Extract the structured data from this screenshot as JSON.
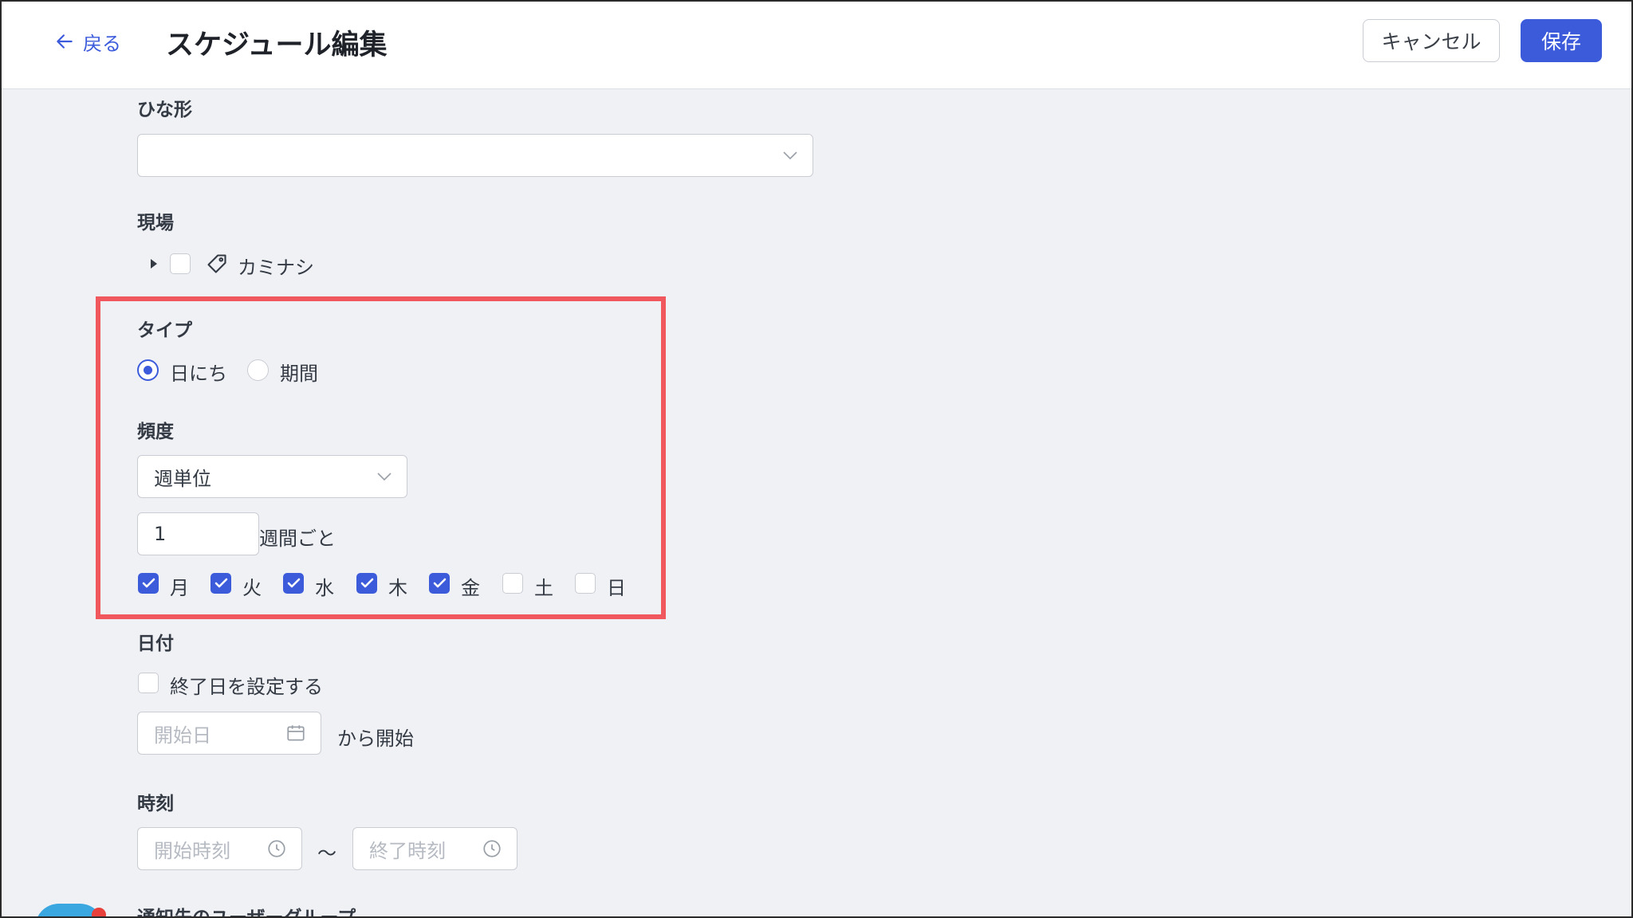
{
  "header": {
    "back_label": "戻る",
    "title": "スケジュール編集",
    "cancel_label": "キャンセル",
    "save_label": "保存"
  },
  "template": {
    "label": "ひな形",
    "value": ""
  },
  "site": {
    "label": "現場",
    "item_label": "カミナシ",
    "checked": false
  },
  "type": {
    "label": "タイプ",
    "options": [
      {
        "label": "日にち",
        "selected": true
      },
      {
        "label": "期間",
        "selected": false
      }
    ]
  },
  "frequency": {
    "label": "頻度",
    "select_value": "週単位",
    "interval_value": "1",
    "interval_suffix": "週間ごと",
    "days": [
      {
        "label": "月",
        "checked": true
      },
      {
        "label": "火",
        "checked": true
      },
      {
        "label": "水",
        "checked": true
      },
      {
        "label": "木",
        "checked": true
      },
      {
        "label": "金",
        "checked": true
      },
      {
        "label": "土",
        "checked": false
      },
      {
        "label": "日",
        "checked": false
      }
    ]
  },
  "date": {
    "label": "日付",
    "set_end_date_label": "終了日を設定する",
    "set_end_date_checked": false,
    "start_placeholder": "開始日",
    "start_suffix": "から開始"
  },
  "time": {
    "label": "時刻",
    "start_placeholder": "開始時刻",
    "separator": "〜",
    "end_placeholder": "終了時刻"
  },
  "notify": {
    "label": "通知先のユーザーグループ"
  },
  "colors": {
    "accent": "#3b5bdb",
    "highlight": "#f0585e",
    "background": "#f0f1f5"
  }
}
